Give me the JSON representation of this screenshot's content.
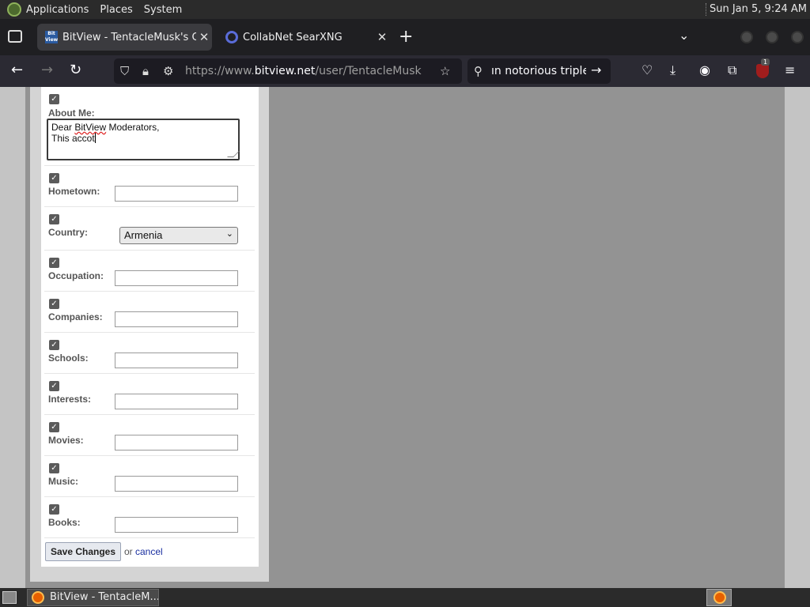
{
  "top_panel": {
    "menus": [
      "Applications",
      "Places",
      "System"
    ],
    "clock": "Sun Jan  5,  9:24 AM"
  },
  "tabs": [
    {
      "title": "BitView - TentacleMusk's Cl",
      "favicon_text": "Bit View"
    },
    {
      "title": "CollabNet SearXNG"
    }
  ],
  "navbar": {
    "url_prefix": "https://www.",
    "url_domain": "bitview.net",
    "url_path": "/user/TentacleMusk",
    "search_text": "ın notorious triple k",
    "ublock_badge": "1"
  },
  "form": {
    "about": {
      "label": "About Me:",
      "line1_a": "Dear ",
      "line1_b": "BitView",
      "line1_c": " Moderators,",
      "line2": "This accot"
    },
    "hometown": {
      "label": "Hometown:"
    },
    "country": {
      "label": "Country:",
      "value": "Armenia"
    },
    "occupation": {
      "label": "Occupation:"
    },
    "companies": {
      "label": "Companies:"
    },
    "schools": {
      "label": "Schools:"
    },
    "interests": {
      "label": "Interests:"
    },
    "movies": {
      "label": "Movies:"
    },
    "music": {
      "label": "Music:"
    },
    "books": {
      "label": "Books:"
    },
    "save_label": "Save Changes",
    "or_label": "or",
    "cancel_label": "cancel"
  },
  "taskbar": {
    "task_title": "BitView - TentacleM..."
  },
  "colors": {
    "panel": "#2b2b2b",
    "toolbar": "#2b2a33",
    "page_bg": "#939393",
    "link": "#1a2fa0"
  }
}
